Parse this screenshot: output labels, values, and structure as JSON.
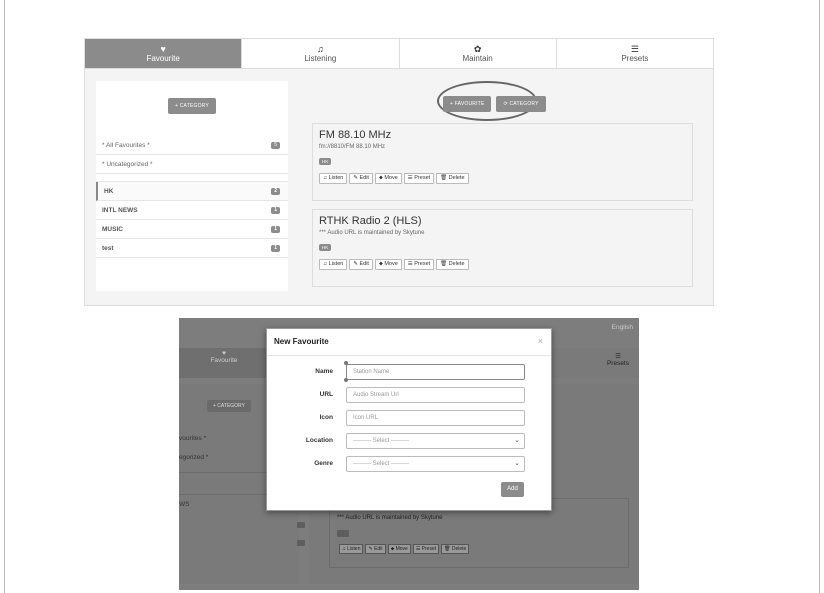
{
  "tabs": [
    {
      "icon": "heart-icon",
      "glyph": "♥",
      "label": "Favourite",
      "active": true
    },
    {
      "icon": "music-icon",
      "glyph": "♫",
      "label": "Listening",
      "active": false
    },
    {
      "icon": "gear-icon",
      "glyph": "✿",
      "label": "Maintain",
      "active": false
    },
    {
      "icon": "list-icon",
      "glyph": "☰",
      "label": "Presets",
      "active": false
    }
  ],
  "sidebar": {
    "add_category_label": "+ CATEGORY",
    "items": [
      {
        "label": "* All Favourites *",
        "count": "5"
      },
      {
        "label": "* Uncategorized *",
        "count": ""
      },
      {
        "label": "HK",
        "count": "2"
      },
      {
        "label": "INTL NEWS",
        "count": "1"
      },
      {
        "label": "MUSIC",
        "count": "1"
      },
      {
        "label": "test",
        "count": "1"
      }
    ]
  },
  "main": {
    "add_favourite_label": "+ FAVOURITE",
    "category_label": "⟳ CATEGORY",
    "stations": [
      {
        "title": "FM 88.10 MHz",
        "subtitle": "fm://8810/FM 88.10 MHz",
        "tag": "HK"
      },
      {
        "title": "RTHK Radio 2 (HLS)",
        "subtitle": "*** Audio URL is maintained by Skytune",
        "tag": "HK"
      }
    ],
    "actions": [
      "♫ Listen",
      "✎ Edit",
      "⬥ Move",
      "☰ Preset",
      "🗑 Delete"
    ]
  },
  "background_app": {
    "language": "English",
    "favourite_tab": "Favourite",
    "presets_tab": "Presets",
    "add_category_label": "+ CATEGORY",
    "sidebar_fragments": [
      "vourites *",
      "egorized *",
      "WS"
    ],
    "station_subtitle": "*** Audio URL is maintained by Skytune",
    "station_tag": "HK",
    "actions": [
      "♫ Listen",
      "✎ Edit",
      "⬥ Move",
      "☰ Preset",
      "🗑 Delete"
    ]
  },
  "modal": {
    "title": "New Favourite",
    "close": "×",
    "fields": [
      {
        "label": "Name",
        "placeholder": "Station Name"
      },
      {
        "label": "URL",
        "placeholder": "Audio Stream Url"
      },
      {
        "label": "Icon",
        "placeholder": "Icon URL"
      },
      {
        "label": "Location",
        "placeholder": "--------- Select ---------"
      },
      {
        "label": "Genre",
        "placeholder": "--------- Select ---------"
      }
    ],
    "add_label": "Add"
  }
}
